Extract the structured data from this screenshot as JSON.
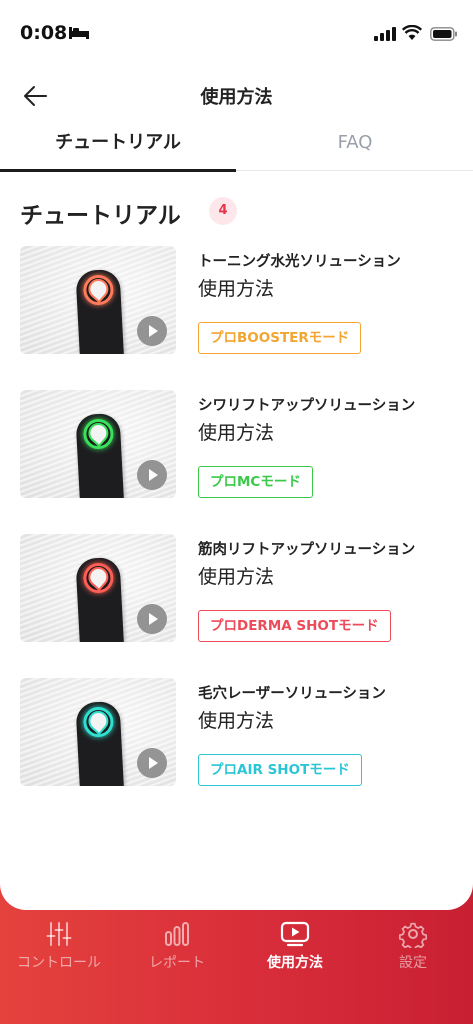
{
  "status_bar": {
    "time": "0:08"
  },
  "header": {
    "title": "使用方法"
  },
  "tabs": [
    {
      "label": "チュートリアル",
      "active": true
    },
    {
      "label": "FAQ",
      "active": false
    }
  ],
  "section": {
    "title": "チュートリアル",
    "count": "4"
  },
  "tutorials": [
    {
      "title": "トーニング水光ソリューション",
      "subtitle": "使用方法",
      "mode": "プロBOOSTERモード",
      "color": "#f2a531",
      "light": "#ff7a5a"
    },
    {
      "title": "シワリフトアップソリューション",
      "subtitle": "使用方法",
      "mode": "プロMCモード",
      "color": "#3bc94b",
      "light": "#39e05a"
    },
    {
      "title": "筋肉リフトアップソリューション",
      "subtitle": "使用方法",
      "mode": "プロDERMA SHOTモード",
      "color": "#ee4b5a",
      "light": "#ff5e55"
    },
    {
      "title": "毛穴レーザーソリューション",
      "subtitle": "使用方法",
      "mode": "プロAIR SHOTモード",
      "color": "#2bc6d6",
      "light": "#2fe0d0"
    }
  ],
  "nav": [
    {
      "label": "コントロール",
      "icon": "sliders-icon",
      "active": false
    },
    {
      "label": "レポート",
      "icon": "bar-chart-icon",
      "active": false
    },
    {
      "label": "使用方法",
      "icon": "play-video-icon",
      "active": true
    },
    {
      "label": "設定",
      "icon": "gear-icon",
      "active": false
    }
  ]
}
